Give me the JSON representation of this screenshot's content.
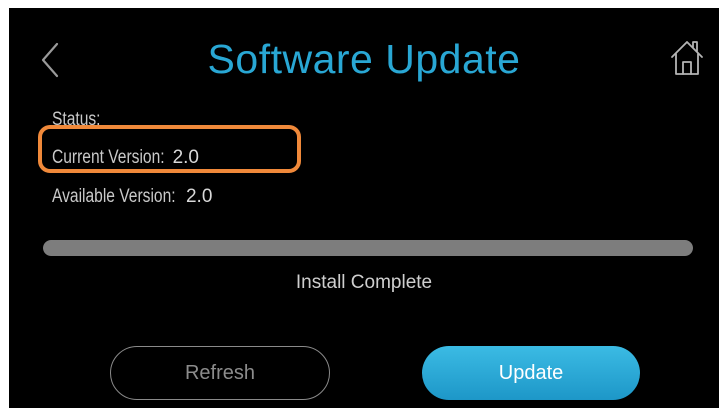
{
  "header": {
    "title": "Software Update",
    "back_icon": "chevron-left-icon",
    "home_icon": "home-icon"
  },
  "info": {
    "status_label": "Status:",
    "current_label": "Current Version:",
    "current_value": "2.0",
    "available_label": "Available Version:",
    "available_value": "2.0"
  },
  "progress": {
    "fraction": 1.0,
    "status_text": "Install Complete"
  },
  "buttons": {
    "refresh_label": "Refresh",
    "update_label": "Update"
  },
  "colors": {
    "accent": "#29a7d4",
    "highlight": "#f0893a",
    "background": "#000000"
  }
}
